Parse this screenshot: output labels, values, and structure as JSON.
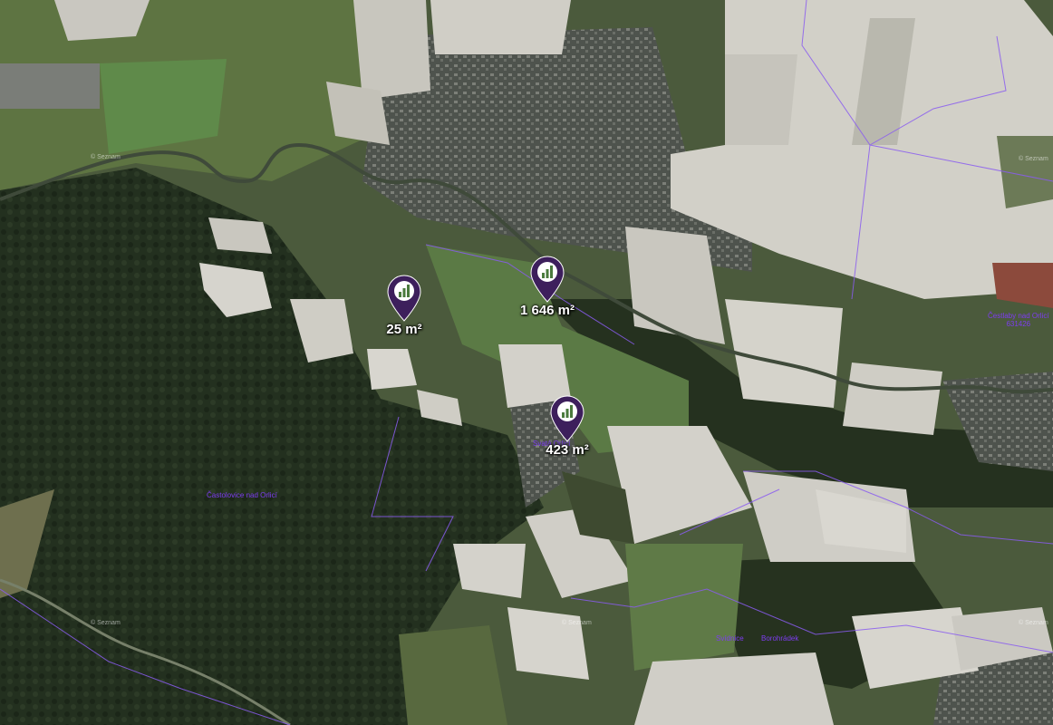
{
  "map": {
    "colors": {
      "forest": "#23301f",
      "meadow": "#5e7442",
      "field_snow": "#d2d0c8",
      "town": "#555a54",
      "river": "#3f4a3a",
      "cadastral_border": "#8a5cf0",
      "marker_fill": "#3d1f5c",
      "marker_label": "#ffffff"
    },
    "markers": [
      {
        "area_label": "25 m²",
        "icon": "parcel-bars-icon"
      },
      {
        "area_label": "1 646 m²",
        "icon": "parcel-bars-icon"
      },
      {
        "area_label": "423 m²",
        "icon": "parcel-bars-icon"
      }
    ],
    "place_labels": [
      {
        "line1": "Častolovice nad Orlicí",
        "line2": ""
      },
      {
        "line1": "Svatá Orlicí",
        "line2": ""
      },
      {
        "line1": "Čestlaby nad Orlicí",
        "line2": "631426"
      },
      {
        "line1": "Svídnice",
        "line2": ""
      },
      {
        "line1": "Borohrádek",
        "line2": ""
      }
    ],
    "copyright_label": "© Seznam"
  }
}
